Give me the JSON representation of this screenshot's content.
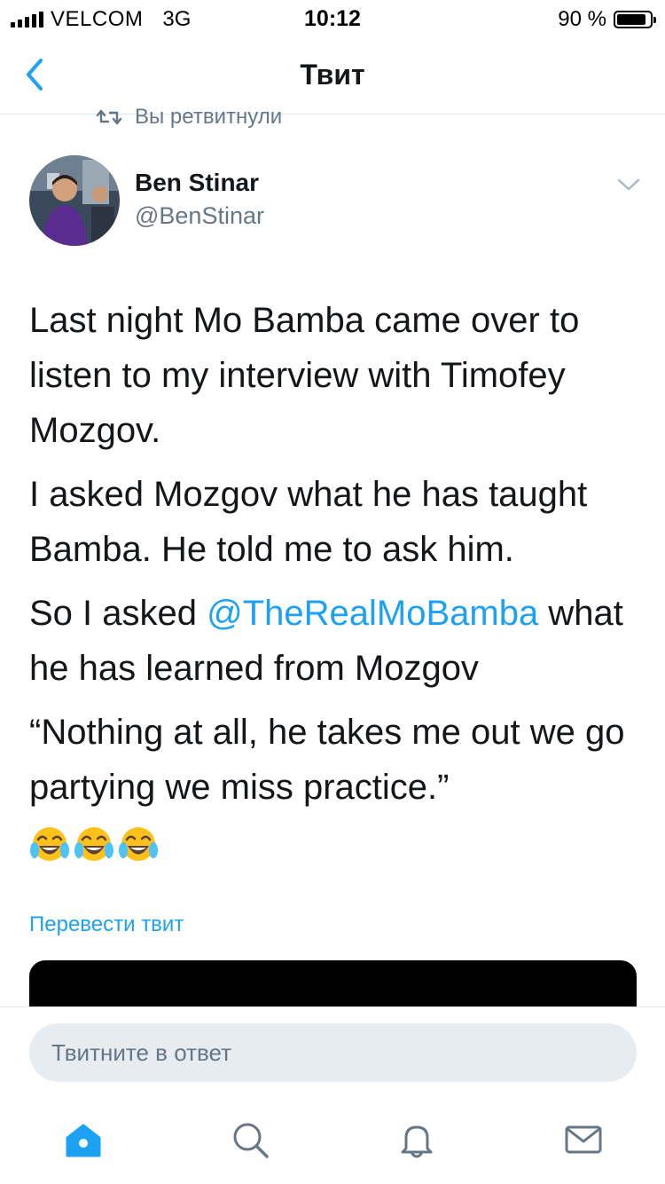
{
  "status_bar": {
    "carrier": "VELCOM",
    "network": "3G",
    "time": "10:12",
    "battery_percent": "90 %",
    "battery_level": 0.9
  },
  "nav": {
    "title": "Твит"
  },
  "retweet_context": {
    "text": "Вы ретвитнули"
  },
  "author": {
    "name": "Ben Stinar",
    "handle": "@BenStinar"
  },
  "tweet": {
    "p1": "Last night Mo Bamba came over to listen to my interview with Timofey Mozgov.",
    "p2": "I asked Mozgov what he has taught Bamba. He told me to ask him.",
    "p3_before": "So I asked ",
    "p3_mention": "@TheRealMoBamba",
    "p3_after": " what he has learned from Mozgov",
    "p4": "“Nothing at all, he takes me out we go partying we miss practice.”",
    "emojis": [
      "tears-of-joy",
      "tears-of-joy",
      "tears-of-joy"
    ]
  },
  "translate_link": "Перевести твит",
  "reply": {
    "placeholder": "Твитните в ответ"
  },
  "tabs": [
    "home",
    "search",
    "notifications",
    "messages"
  ],
  "colors": {
    "accent": "#1da1f2",
    "text": "#14171a",
    "secondary": "#657786",
    "divider": "#e1e8ed",
    "input_bg": "#e6ecf0"
  }
}
